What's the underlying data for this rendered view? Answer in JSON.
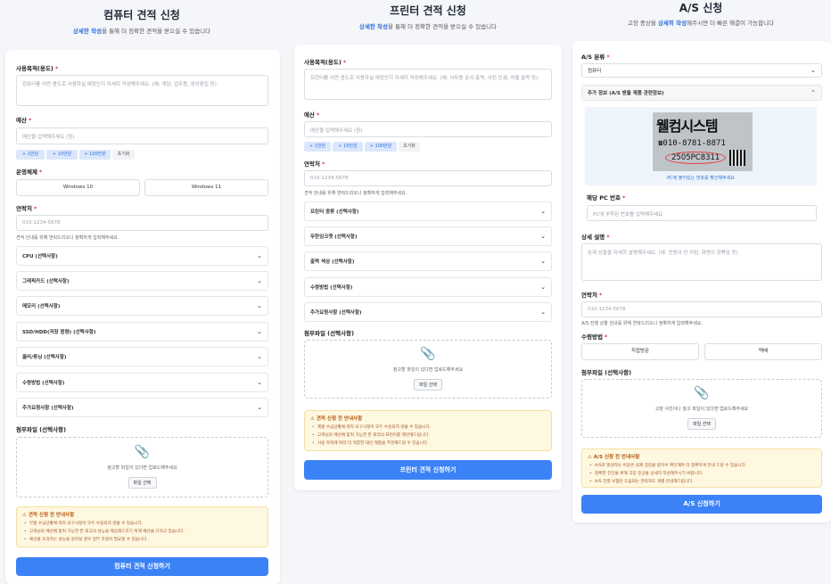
{
  "computer": {
    "title": "컴퓨터 견적 신청",
    "subtitle_strong": "상세한 작성",
    "subtitle_rest": "을 통해 더 정확한 견적을 받으실 수 있습니다",
    "purpose_label": "사용목적(용도)",
    "purpose_placeholder": "컴퓨터를 어떤 용도로 사용하실 예정인지 자세히 작성해주세요. (예: 게임, 업무용, 영상편집 등)",
    "budget_label": "예산",
    "budget_placeholder": "예산을 입력해주세요 (원)",
    "budget_buttons": [
      "+ 1만원",
      "+ 10만원",
      "+ 100만원",
      "초기화"
    ],
    "os_label": "운영체제",
    "os_options": [
      "Windows 10",
      "Windows 11"
    ],
    "contact_label": "연락처",
    "contact_placeholder": "010-1234-5678",
    "contact_hint": "견적 안내를 위해 연락드리오니 정확하게 입력해주세요.",
    "accordions": [
      "CPU (선택사항)",
      "그래픽카드 (선택사항)",
      "메모리 (선택사항)",
      "SSD/HDD(저장 용량) (선택사항)",
      "쿨러/튜닝 (선택사항)",
      "수령방법 (선택사항)",
      "추가요청사항 (선택사항)"
    ],
    "file_label": "첨부파일 (선택사항)",
    "file_text": "참고할 파일이 있다면 업로드해주세요",
    "file_button": "파일 선택",
    "notice_title": "견적 신청 전 안내사항",
    "notice_items": [
      "부품 수급상황에 따라 요구사항이 모두 수용되지 않을 수 있습니다.",
      "고객님의 예산에 맞춰 가능한 한 최고의 성능을 제공해드리기 위해 예산을 다하고 있습니다.",
      "예산을 초과하는 성능을 원하실 경우 일부 조정이 필요할 수 있습니다."
    ],
    "submit": "컴퓨터 견적 신청하기"
  },
  "printer": {
    "title": "프린터 견적 신청",
    "subtitle_strong": "상세한 작성",
    "subtitle_rest": "을 통해 더 정확한 견적을 받으실 수 있습니다",
    "purpose_label": "사용목적(용도)",
    "purpose_placeholder": "프린터를 어떤 용도로 사용하실 예정인지 자세히 작성해주세요. (예: 사무용 문서 출력, 사진 인쇄, 라벨 출력 등)",
    "budget_label": "예산",
    "budget_placeholder": "예산을 입력해주세요 (원)",
    "budget_buttons": [
      "+ 1만원",
      "+ 10만원",
      "+ 100만원",
      "초기화"
    ],
    "contact_label": "연락처",
    "contact_placeholder": "010-1234-5678",
    "contact_hint": "견적 안내를 위해 연락드리오니 정확하게 입력해주세요.",
    "accordions": [
      "프린터 종류 (선택사항)",
      "무한잉크젯 (선택사항)",
      "출력 색상 (선택사항)",
      "수령방법 (선택사항)",
      "추가요청사항 (선택사항)"
    ],
    "file_label": "첨부파일 (선택사항)",
    "file_text": "참고할 파일이 있다면 업로드해주세요",
    "file_button": "파일 선택",
    "notice_title": "견적 신청 전 안내사항",
    "notice_items": [
      "제품 수급상황에 따라 요구사항이 모두 수용되지 않을 수 있습니다.",
      "고객님의 예산에 맞춰 가능한 한 최적의 프린터를 제안해드립니다.",
      "사용 목적에 따라 더 적합한 대안 제품을 추천해드릴 수 있습니다."
    ],
    "submit": "프린터 견적 신청하기"
  },
  "as": {
    "title": "A/S 신청",
    "subtitle_pre": "고장 증상을 ",
    "subtitle_strong": "상세히 작성",
    "subtitle_rest": "해주시면 더 빠른 해결이 가능합니다",
    "type_label": "A/S 분류",
    "type_value": "컴퓨터",
    "extra_title": "추가 정보 (A/S 받을 제품 관련정보)",
    "sticker_brand": "웰컴시스템",
    "sticker_phone": "☎010-8781-8871",
    "sticker_code": "2505PC8311",
    "sticker_caption": "PC에 붙어있는 번호를 확인해주세요",
    "pc_number_label": "해당 PC 번호",
    "pc_number_placeholder": "PC에 부착된 번호를 입력해주세요",
    "symptom_label": "상세 설명",
    "symptom_placeholder": "문제 상황을 자세히 설명해주세요. (예: 전원이 안 켜짐, 화면이 깜빡임 등)",
    "contact_label": "연락처",
    "contact_placeholder": "010-1234-5678",
    "contact_hint": "A/S 진행 상황 안내를 위해 연락드리오니 정확하게 입력해주세요.",
    "method_label": "수령방법",
    "method_options": [
      "직접방문",
      "택배"
    ],
    "file_label": "첨부파일 (선택사항)",
    "file_text": "고장 사진이나 참고 파일이 있다면 업로드해주세요",
    "file_button": "파일 선택",
    "notice_title": "A/S 신청 전 안내사항",
    "notice_items": [
      "A/S로 발생하는 비용은 실제 점검을 받아서 확인해야 더 정확하게 안내 드릴 수 있습니다.",
      "정확한 진단을 위해 고장 증상을 상세히 작성해주시기 바랍니다.",
      "A/S 진행 보험은 도움되는 연락처도 개별 안내해드립니다."
    ],
    "submit": "A/S 신청하기"
  },
  "colors": {
    "accent": "#3b82f6",
    "required": "#e53e3e",
    "notice_bg": "#fff8e1"
  }
}
